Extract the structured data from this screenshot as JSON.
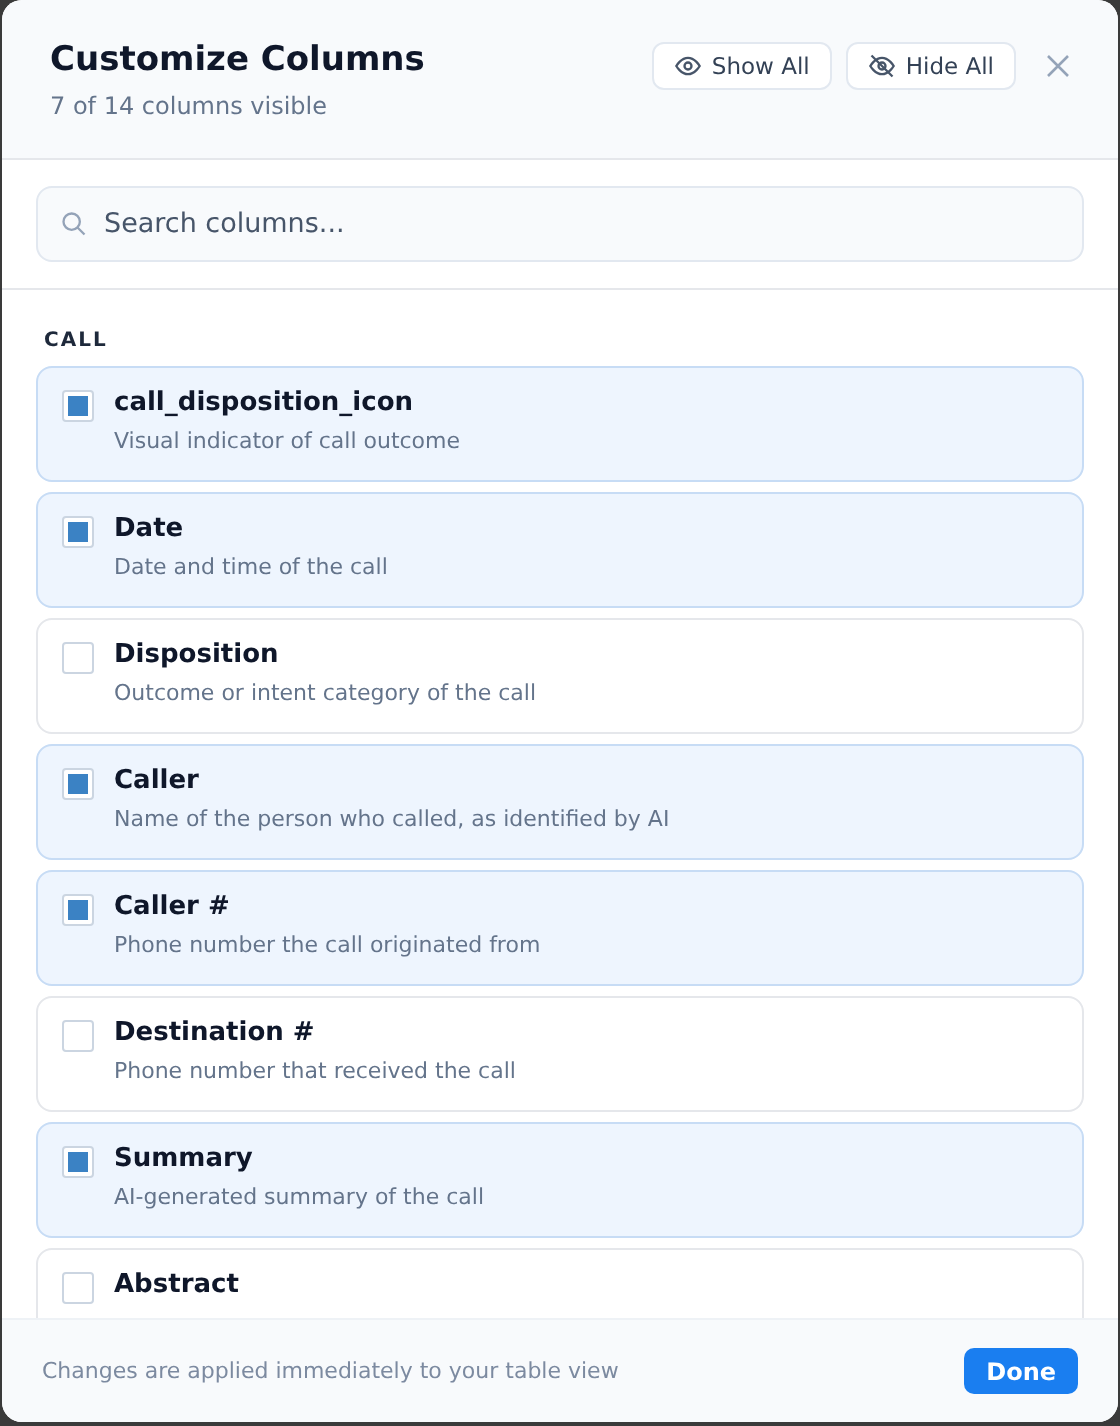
{
  "dialog": {
    "title": "Customize Columns",
    "subtitle": "7 of 14 columns visible",
    "show_all": "Show All",
    "hide_all": "Hide All"
  },
  "search": {
    "placeholder": "Search columns..."
  },
  "groups": [
    {
      "name": "CALL",
      "columns": [
        {
          "name": "call_disposition_icon",
          "description": "Visual indicator of call outcome",
          "checked": true
        },
        {
          "name": "Date",
          "description": "Date and time of the call",
          "checked": true
        },
        {
          "name": "Disposition",
          "description": "Outcome or intent category of the call",
          "checked": false
        },
        {
          "name": "Caller",
          "description": "Name of the person who called, as identified by AI",
          "checked": true
        },
        {
          "name": "Caller #",
          "description": "Phone number the call originated from",
          "checked": true
        },
        {
          "name": "Destination #",
          "description": "Phone number that received the call",
          "checked": false
        },
        {
          "name": "Summary",
          "description": "AI-generated summary of the call",
          "checked": true
        },
        {
          "name": "Abstract",
          "checked": false
        }
      ]
    }
  ],
  "footer": {
    "note": "Changes are applied immediately to your table view",
    "done": "Done"
  }
}
